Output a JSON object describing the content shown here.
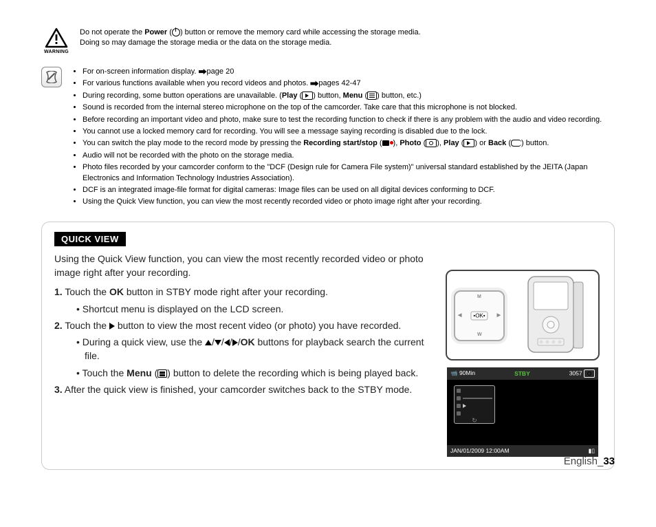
{
  "warning": {
    "label": "WARNING",
    "line1_a": "Do not operate the ",
    "line1_b": "Power",
    "line1_c": " button or remove the memory card while accessing the storage media.",
    "line2": "Doing so may damage the storage media or the data on the storage media."
  },
  "notes": {
    "n1_a": "For on-screen information display. ",
    "n1_b": "page 20",
    "n2_a": "For various functions available when you record videos and photos. ",
    "n2_b": "pages 42-47",
    "n3_a": "During recording, some button operations are unavailable. (",
    "n3_play": "Play",
    "n3_b": " button, ",
    "n3_menu": "Menu",
    "n3_c": " button, etc.)",
    "n4": "Sound is recorded from the internal stereo microphone on the top of the camcorder. Take care that this microphone is not blocked.",
    "n5": "Before recording an important video and photo, make sure to test the recording function to check if there is any problem with the audio and video recording.",
    "n6": "You cannot use a locked memory card for recording. You will see a message saying recording is disabled due to the lock.",
    "n7_a": "You can switch the play mode to the record mode by pressing the ",
    "n7_rs": "Recording start/stop",
    "n7_b": ", ",
    "n7_photo": "Photo",
    "n7_c": ", ",
    "n7_play": "Play",
    "n7_d": " or ",
    "n7_back": "Back",
    "n7_e": " button.",
    "n8": "Audio will not be recorded with the photo on the storage media.",
    "n9": "Photo files recorded by your camcorder conform to the \"DCF (Design rule for Camera File system)\" universal standard established by the JEITA (Japan Electronics and Information Technology Industries Association).",
    "n10": "DCF is an integrated image-file format for digital cameras: Image files can be used on all digital devices conforming to DCF.",
    "n11": "Using the Quick View function, you can view the most recently recorded video or photo image right after your recording."
  },
  "quickview": {
    "title": "QUICK VIEW",
    "intro": "Using the Quick View function, you can view the most recently recorded video or photo image right after your recording.",
    "s1_num": "1.",
    "s1_a": " Touch the ",
    "s1_ok": "OK",
    "s1_b": " button in STBY mode right after your recording.",
    "s1_sub1": "Shortcut menu is displayed on the LCD screen.",
    "s2_num": "2.",
    "s2_a": " Touch the ",
    "s2_b": " button to view the most recent video (or photo) you have recorded.",
    "s2_sub1_a": "During a quick view, use the ",
    "s2_sub1_ok": "OK",
    "s2_sub1_b": " buttons for playback search the current file.",
    "s2_sub2_a": "Touch the ",
    "s2_sub2_menu": "Menu",
    "s2_sub2_b": " button to delete the recording which is being played back.",
    "s3_num": "3.",
    "s3_a": " After the quick view is finished, your camcorder switches back to the STBY mode."
  },
  "screen": {
    "time": "90Min",
    "stby": "STBY",
    "count": "3057",
    "date": "JAN/01/2009 12:00AM"
  },
  "footer": {
    "lang": "English_",
    "page": "33"
  }
}
